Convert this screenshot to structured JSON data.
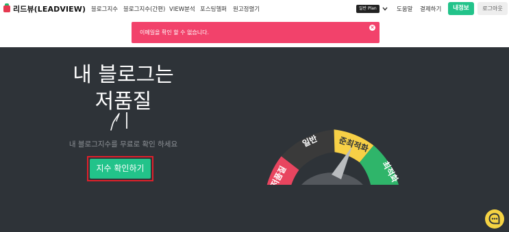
{
  "brand": {
    "name": "리드뷰(LEADVIEW)"
  },
  "nav": {
    "items": [
      "블로그지수",
      "블로그지수(간편)",
      "VIEW분석",
      "포스팅헬퍼",
      "원고정렬기"
    ],
    "plan_badge": "일반 Plan",
    "help": "도움말",
    "payment": "결제하기",
    "my_info": "내정보",
    "logout": "로그아웃"
  },
  "alert": {
    "message": "이메일을 확인 할 수 없습니다.",
    "close_glyph": "×"
  },
  "hero": {
    "title_line1": "내 블로그는",
    "title_line2": "저품질",
    "subtitle": "내 블로그지수를 무료로 확인 하세요",
    "cta_label": "지수 확인하기"
  },
  "gauge": {
    "segments": [
      {
        "label": "저품질",
        "color": "#e8455f"
      },
      {
        "label": "일반",
        "color": "#3a3a3a"
      },
      {
        "label": "준최적화",
        "color": "#f7d046"
      },
      {
        "label": "최적화",
        "color": "#2fb56a"
      }
    ]
  },
  "colors": {
    "accent": "#22c38a",
    "alert": "#f2426b",
    "hero_bg": "#2e3338",
    "chat": "#f5d343"
  }
}
